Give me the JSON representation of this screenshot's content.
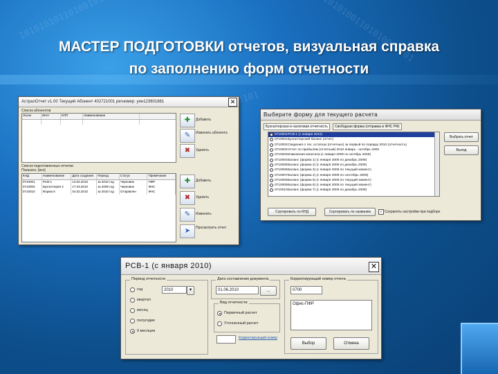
{
  "slide": {
    "title_line1": "МАСТЕР ПОДГОТОВКИ  отчетов, визуальная справка",
    "title_line2": "по заполнению форм отчетности",
    "bg_digits": [
      "10101010110100101001010",
      "0110101001101010010101",
      "10110101001010100101"
    ]
  },
  "main_window": {
    "title": "АстралОтчет v1.00 Текущий Абонент 402721001 регномер: уин123601881",
    "section1_label": "Список абонентов",
    "grid1_columns": [
      "Логин",
      "ИНН",
      "КПП",
      "Наименование"
    ],
    "grid1_rows": [
      [
        "",
        "",
        "",
        ""
      ]
    ],
    "side_buttons_top": [
      {
        "icon": "add-icon",
        "label": "Добавить"
      },
      {
        "icon": "edit-icon",
        "label": "Изменить абонента"
      },
      {
        "icon": "delete-icon",
        "label": "Удалить"
      }
    ],
    "section2_label": "Список подготовленных отчетов",
    "section2_sub": "Показать: [все]",
    "grid2_columns": [
      "КНД",
      "Наименование",
      "Дата создания",
      "Период",
      "Статус",
      "Примечание"
    ],
    "grid2_rows": [
      [
        "0710001",
        "РСВ-1",
        "13.04.2010",
        "за 2010 год",
        "Черновик",
        "ПФР"
      ],
      [
        "0710002",
        "Бухгалтерия 2",
        "17.03.2010",
        "за 2009 год",
        "Черновик",
        "ФНС"
      ],
      [
        "0710010",
        "Форма 6",
        "04.02.2010",
        "за 2010 год",
        "Отправлен",
        "ФНС"
      ]
    ],
    "side_buttons_bottom": [
      {
        "icon": "add-icon",
        "label": "Добавить"
      },
      {
        "icon": "delete-icon",
        "label": "Удалить"
      },
      {
        "icon": "edit-icon",
        "label": "Изменить"
      },
      {
        "icon": "send-icon",
        "label": "Просмотреть отчет"
      }
    ]
  },
  "form_window": {
    "title": "Выберите форму для текущего расчета",
    "tabs": [
      "Бухгалтерская и налоговая отчетность",
      "Свободная форма (отправка в ФНС РФ)"
    ],
    "items": [
      {
        "code": "0710001",
        "name": "РСВ-1 (с января 2010)",
        "selected": true
      },
      {
        "code": "0710001",
        "name": "Бухгалтерский баланс (отчет)",
        "selected": false
      },
      {
        "code": "0710002",
        "name": "Сведения о тех. остатках (отчетных) за первый по порядку 2010 (отчетность)",
        "selected": false
      },
      {
        "code": "0710002",
        "name": "Отчет по прибылям (отчетный) 2010 январь - октябрь 2009",
        "selected": false
      },
      {
        "code": "0710003",
        "name": "Изменения капитала (с января 2009 по октябрь 2009)",
        "selected": false
      },
      {
        "code": "0710004",
        "name": "Баланс (форма 1) (с января 2009 по декабрь 2009)",
        "selected": false
      },
      {
        "code": "0710005",
        "name": "Баланс (форма 2) (с января 2009 по декабрь 2009)",
        "selected": false
      },
      {
        "code": "0710006",
        "name": "Баланс (форма 3) (с января 2009 по текущий момент)",
        "selected": false
      },
      {
        "code": "0710007",
        "name": "Баланс (форма 4) (с января 2009 по сентябрь 2009)",
        "selected": false
      },
      {
        "code": "0710008",
        "name": "Баланс (форма 5) (с января 2009 по текущий момент)",
        "selected": false
      },
      {
        "code": "0710009",
        "name": "Баланс (форма 6) (с января 2009 по текущий момент)",
        "selected": false
      },
      {
        "code": "0710010",
        "name": "Баланс (форма 7) (с января 2009 по декабрь 2009)",
        "selected": false
      }
    ],
    "right_buttons": [
      "Выбрать отчет",
      "Выход"
    ],
    "bottom_buttons": [
      "Сортировать по КНД",
      "Сортировать по названию"
    ],
    "checkbox_label": "Сохранять настройки при подборе"
  },
  "rsv_window": {
    "title": "РСВ-1 (с января 2010)",
    "period_group": "Период отчетности",
    "period_options": [
      "год",
      "квартал",
      "месяц",
      "полугодие",
      "9 месяцев"
    ],
    "period_selected": 4,
    "year_value": "2010",
    "date_group": "Дата составления документа",
    "date_value": "01.06.2010",
    "date_btn": "...",
    "corr_group": "Корректирующий номер отчета",
    "corr_value": "0700",
    "type_group": "Вид отчетности",
    "type_options": [
      "Первичный расчет",
      "Уточненный расчет"
    ],
    "type_selected": 0,
    "corr_link": "Корректирующий номер",
    "field_value": "Офис-ПФР",
    "ok_btn": "Выбор",
    "cancel_btn": "Отмена"
  }
}
